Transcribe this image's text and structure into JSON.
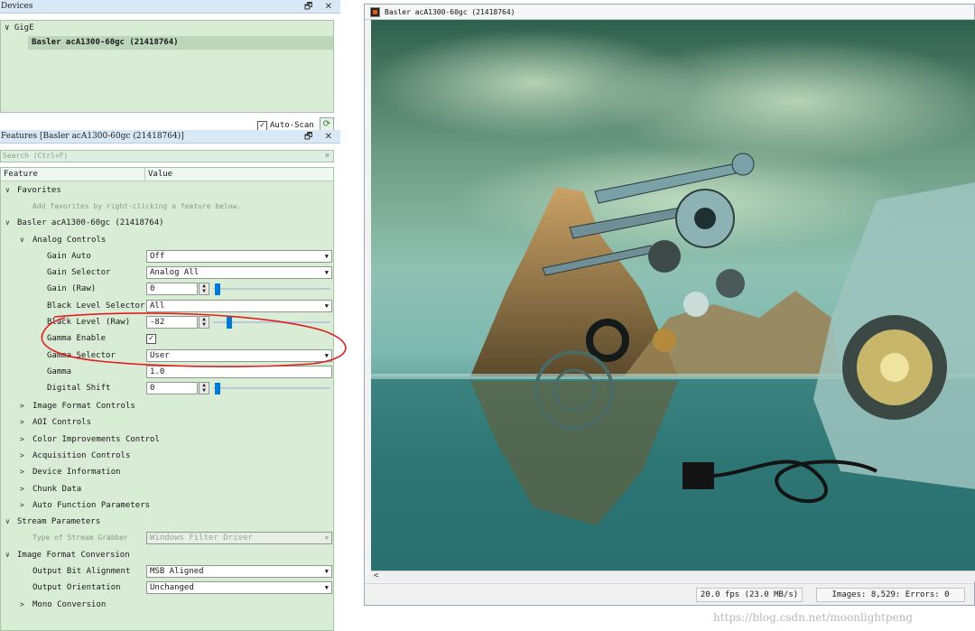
{
  "devices": {
    "title": "Devices",
    "window_controls": "🗗 ✕",
    "root_label": "GigE",
    "device_name": "Basler acA1300-60gc (21418764)",
    "auto_scan_label": "Auto-Scan",
    "auto_scan_checked": "✓"
  },
  "features": {
    "title": "Features [Basler acA1300-60gc (21418764)]",
    "window_controls": "🗗 ✕",
    "search_placeholder": "Search (Ctrl+F)",
    "col_feature": "Feature",
    "col_value": "Value",
    "favorites_label": "Favorites",
    "favorites_hint": "Add favorites by right-clicking a feature below.",
    "camera_label": "Basler acA1300-60gc (21418764)",
    "analog_controls": "Analog Controls",
    "gain_auto": {
      "label": "Gain Auto",
      "value": "Off"
    },
    "gain_selector": {
      "label": "Gain Selector",
      "value": "Analog All"
    },
    "gain_raw": {
      "label": "Gain (Raw)",
      "value": "0",
      "slider_fraction": 0.0
    },
    "black_level_selector": {
      "label": "Black Level Selector",
      "value": "All"
    },
    "black_level_raw": {
      "label": "Black Level (Raw)",
      "value": "-82",
      "slider_fraction": 0.1
    },
    "gamma_enable": {
      "label": "Gamma Enable",
      "checked": "✓"
    },
    "gamma_selector": {
      "label": "Gamma Selector",
      "value": "User"
    },
    "gamma": {
      "label": "Gamma",
      "value": "1.0"
    },
    "digital_shift": {
      "label": "Digital Shift",
      "value": "0",
      "slider_fraction": 0.0
    },
    "groups": [
      "Image Format Controls",
      "AOI Controls",
      "Color Improvements Control",
      "Acquisition Controls",
      "Device Information",
      "Chunk Data",
      "Auto Function Parameters"
    ],
    "stream_parameters": "Stream Parameters",
    "stream_grabber": {
      "label": "Type of Stream Grabber",
      "value": "Windows Filter Driver"
    },
    "image_format_conversion": "Image Format Conversion",
    "output_bit_alignment": {
      "label": "Output Bit Alignment",
      "value": "MSB Aligned"
    },
    "output_orientation": {
      "label": "Output Orientation",
      "value": "Unchanged"
    },
    "mono_conversion": "Mono Conversion"
  },
  "image_window": {
    "title": "Basler acA1300-60gc (21418764)",
    "status_fps": "20.0 fps (23.0 MB/s)",
    "status_images": "Images: 8,529: Errors: 0"
  },
  "watermark": "https://blog.csdn.net/moonlightpeng",
  "colors": {
    "panel_green": "#d8ecd6",
    "selection_green": "#bcd6bb",
    "slider_blue": "#0078d7",
    "annotation_red": "#e02020"
  },
  "icons": {
    "expanded": "chevron-down-icon",
    "collapsed": "chevron-right-icon",
    "search": "search-icon",
    "refresh": "refresh-icon"
  }
}
